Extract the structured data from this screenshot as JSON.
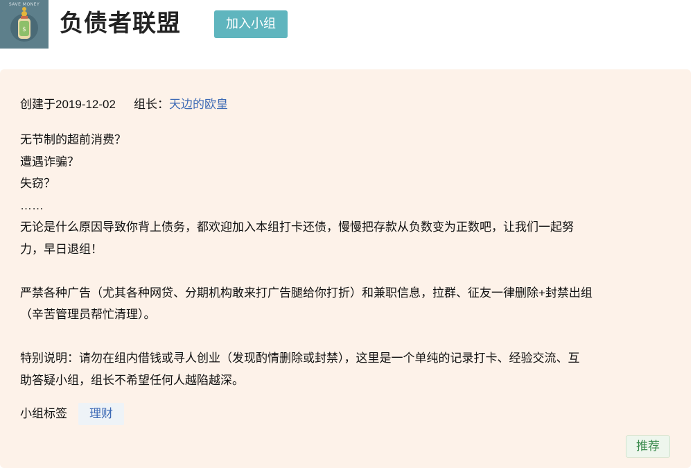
{
  "header": {
    "avatar_caption": "SAVE MONEY",
    "group_title": "负债者联盟",
    "join_label": "加入小组"
  },
  "card": {
    "created_text": "创建于2019-12-02",
    "leader_label": "组长：",
    "leader_name": "天边的欧皇",
    "description_lines": [
      "无节制的超前消费？",
      "遭遇诈骗？",
      "失窃？",
      "……",
      "无论是什么原因导致你背上债务，都欢迎加入本组打卡还债，慢慢把存款从负数变为正数吧，让我们一起努",
      "力，早日退组！",
      "",
      "严禁各种广告（尤其各种网贷、分期机构敢来打广告腿给你打折）和兼职信息，拉群、征友一律删除+封禁出组",
      "（辛苦管理员帮忙清理）。",
      "",
      "特别说明：请勿在组内借钱或寻人创业（发现酌情删除或封禁），这里是一个单纯的记录打卡、经验交流、互",
      "助答疑小组，组长不希望任何人越陷越深。"
    ],
    "tags_label": "小组标签",
    "tag": "理财",
    "recommend_label": "推荐"
  }
}
